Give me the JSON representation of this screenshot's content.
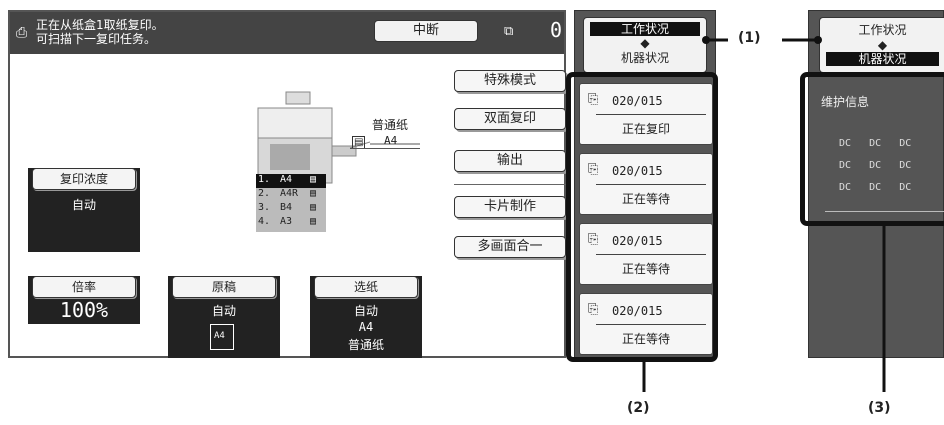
{
  "status": {
    "line1": "正在从纸盒1取纸复印。",
    "line2": "可扫描下一复印任务。",
    "interrupt_label": "中断",
    "count": "0"
  },
  "modes": {
    "special": "特殊模式",
    "duplex": "双面复印",
    "output": "输出",
    "card_shot": "卡片制作",
    "n_up": "多画面合一"
  },
  "machine": {
    "paper_type": "普通纸",
    "paper_size": "A4",
    "trays": [
      {
        "num": "1.",
        "size": "A4"
      },
      {
        "num": "2.",
        "size": "A4R"
      },
      {
        "num": "3.",
        "size": "B4"
      },
      {
        "num": "4.",
        "size": "A3"
      }
    ]
  },
  "settings": {
    "exposure_label": "复印浓度",
    "exposure_value": "自动",
    "ratio_label": "倍率",
    "ratio_value": "100%",
    "original_label": "原稿",
    "original_value": "自动",
    "original_size": "A4",
    "paper_label": "选纸",
    "paper_value": "自动",
    "paper_size": "A4",
    "paper_type": "普通纸"
  },
  "job_panel": {
    "tab_job_status": "工作状况",
    "tab_machine_status": "机器状况",
    "arrow": "◆",
    "jobs": [
      {
        "count": "020/015",
        "status": "正在复印"
      },
      {
        "count": "020/015",
        "status": "正在等待"
      },
      {
        "count": "020/015",
        "status": "正在等待"
      },
      {
        "count": "020/015",
        "status": "正在等待"
      }
    ]
  },
  "machine_panel": {
    "tab_job_status": "工作状况",
    "tab_machine_status": "机器状况",
    "maintenance_title": "维护信息",
    "dc_rows": [
      [
        "DC",
        "DC",
        "DC"
      ],
      [
        "DC",
        "DC",
        "DC"
      ],
      [
        "DC",
        "DC",
        "DC"
      ]
    ]
  },
  "callouts": {
    "one": "(1)",
    "two": "(2)",
    "three": "(3)"
  },
  "colors": {
    "dark": "#444444",
    "panel": "#555555",
    "highlight": "#111111"
  }
}
